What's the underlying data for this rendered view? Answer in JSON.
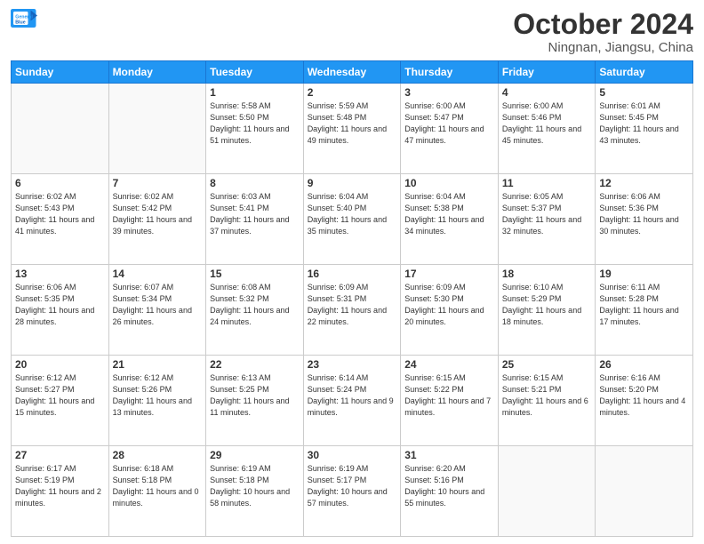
{
  "header": {
    "logo_line1": "General",
    "logo_line2": "Blue",
    "month": "October 2024",
    "location": "Ningnan, Jiangsu, China"
  },
  "weekdays": [
    "Sunday",
    "Monday",
    "Tuesday",
    "Wednesday",
    "Thursday",
    "Friday",
    "Saturday"
  ],
  "weeks": [
    [
      {
        "day": "",
        "info": ""
      },
      {
        "day": "",
        "info": ""
      },
      {
        "day": "1",
        "info": "Sunrise: 5:58 AM\nSunset: 5:50 PM\nDaylight: 11 hours\nand 51 minutes."
      },
      {
        "day": "2",
        "info": "Sunrise: 5:59 AM\nSunset: 5:48 PM\nDaylight: 11 hours\nand 49 minutes."
      },
      {
        "day": "3",
        "info": "Sunrise: 6:00 AM\nSunset: 5:47 PM\nDaylight: 11 hours\nand 47 minutes."
      },
      {
        "day": "4",
        "info": "Sunrise: 6:00 AM\nSunset: 5:46 PM\nDaylight: 11 hours\nand 45 minutes."
      },
      {
        "day": "5",
        "info": "Sunrise: 6:01 AM\nSunset: 5:45 PM\nDaylight: 11 hours\nand 43 minutes."
      }
    ],
    [
      {
        "day": "6",
        "info": "Sunrise: 6:02 AM\nSunset: 5:43 PM\nDaylight: 11 hours\nand 41 minutes."
      },
      {
        "day": "7",
        "info": "Sunrise: 6:02 AM\nSunset: 5:42 PM\nDaylight: 11 hours\nand 39 minutes."
      },
      {
        "day": "8",
        "info": "Sunrise: 6:03 AM\nSunset: 5:41 PM\nDaylight: 11 hours\nand 37 minutes."
      },
      {
        "day": "9",
        "info": "Sunrise: 6:04 AM\nSunset: 5:40 PM\nDaylight: 11 hours\nand 35 minutes."
      },
      {
        "day": "10",
        "info": "Sunrise: 6:04 AM\nSunset: 5:38 PM\nDaylight: 11 hours\nand 34 minutes."
      },
      {
        "day": "11",
        "info": "Sunrise: 6:05 AM\nSunset: 5:37 PM\nDaylight: 11 hours\nand 32 minutes."
      },
      {
        "day": "12",
        "info": "Sunrise: 6:06 AM\nSunset: 5:36 PM\nDaylight: 11 hours\nand 30 minutes."
      }
    ],
    [
      {
        "day": "13",
        "info": "Sunrise: 6:06 AM\nSunset: 5:35 PM\nDaylight: 11 hours\nand 28 minutes."
      },
      {
        "day": "14",
        "info": "Sunrise: 6:07 AM\nSunset: 5:34 PM\nDaylight: 11 hours\nand 26 minutes."
      },
      {
        "day": "15",
        "info": "Sunrise: 6:08 AM\nSunset: 5:32 PM\nDaylight: 11 hours\nand 24 minutes."
      },
      {
        "day": "16",
        "info": "Sunrise: 6:09 AM\nSunset: 5:31 PM\nDaylight: 11 hours\nand 22 minutes."
      },
      {
        "day": "17",
        "info": "Sunrise: 6:09 AM\nSunset: 5:30 PM\nDaylight: 11 hours\nand 20 minutes."
      },
      {
        "day": "18",
        "info": "Sunrise: 6:10 AM\nSunset: 5:29 PM\nDaylight: 11 hours\nand 18 minutes."
      },
      {
        "day": "19",
        "info": "Sunrise: 6:11 AM\nSunset: 5:28 PM\nDaylight: 11 hours\nand 17 minutes."
      }
    ],
    [
      {
        "day": "20",
        "info": "Sunrise: 6:12 AM\nSunset: 5:27 PM\nDaylight: 11 hours\nand 15 minutes."
      },
      {
        "day": "21",
        "info": "Sunrise: 6:12 AM\nSunset: 5:26 PM\nDaylight: 11 hours\nand 13 minutes."
      },
      {
        "day": "22",
        "info": "Sunrise: 6:13 AM\nSunset: 5:25 PM\nDaylight: 11 hours\nand 11 minutes."
      },
      {
        "day": "23",
        "info": "Sunrise: 6:14 AM\nSunset: 5:24 PM\nDaylight: 11 hours\nand 9 minutes."
      },
      {
        "day": "24",
        "info": "Sunrise: 6:15 AM\nSunset: 5:22 PM\nDaylight: 11 hours\nand 7 minutes."
      },
      {
        "day": "25",
        "info": "Sunrise: 6:15 AM\nSunset: 5:21 PM\nDaylight: 11 hours\nand 6 minutes."
      },
      {
        "day": "26",
        "info": "Sunrise: 6:16 AM\nSunset: 5:20 PM\nDaylight: 11 hours\nand 4 minutes."
      }
    ],
    [
      {
        "day": "27",
        "info": "Sunrise: 6:17 AM\nSunset: 5:19 PM\nDaylight: 11 hours\nand 2 minutes."
      },
      {
        "day": "28",
        "info": "Sunrise: 6:18 AM\nSunset: 5:18 PM\nDaylight: 11 hours\nand 0 minutes."
      },
      {
        "day": "29",
        "info": "Sunrise: 6:19 AM\nSunset: 5:18 PM\nDaylight: 10 hours\nand 58 minutes."
      },
      {
        "day": "30",
        "info": "Sunrise: 6:19 AM\nSunset: 5:17 PM\nDaylight: 10 hours\nand 57 minutes."
      },
      {
        "day": "31",
        "info": "Sunrise: 6:20 AM\nSunset: 5:16 PM\nDaylight: 10 hours\nand 55 minutes."
      },
      {
        "day": "",
        "info": ""
      },
      {
        "day": "",
        "info": ""
      }
    ]
  ]
}
